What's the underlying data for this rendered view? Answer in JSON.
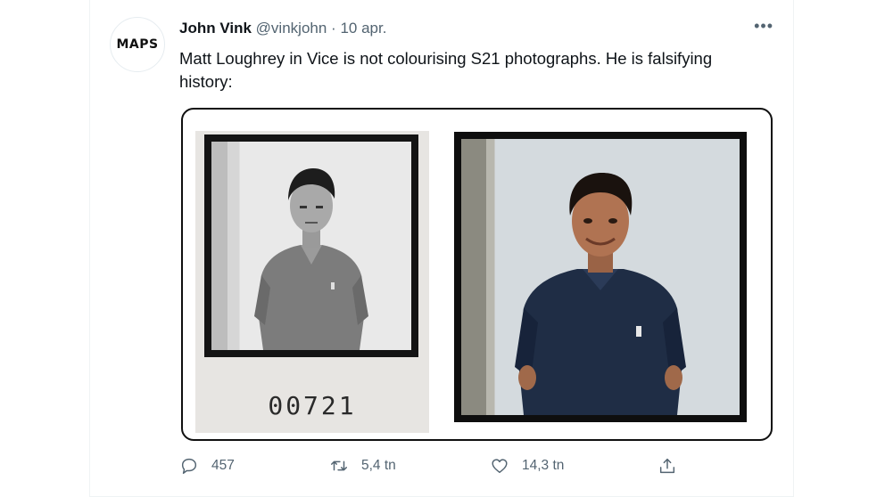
{
  "tweet": {
    "avatar_label": "MAPS",
    "author_name": "John Vink",
    "author_handle": "@vinkjohn",
    "separator": "·",
    "date": "10 apr.",
    "more_label": "•••",
    "text": "Matt Loughrey in Vice is not colourising S21 photographs. He is falsifying history:"
  },
  "media": {
    "left_photo_number": "00721"
  },
  "actions": {
    "replies": "457",
    "retweets": "5,4 tn",
    "likes": "14,3 tn"
  },
  "icons": [
    "comment-icon",
    "retweet-icon",
    "heart-icon",
    "share-icon"
  ],
  "colors": {
    "text_primary": "#0f1419",
    "text_secondary": "#536471",
    "border": "#eff3f4"
  }
}
